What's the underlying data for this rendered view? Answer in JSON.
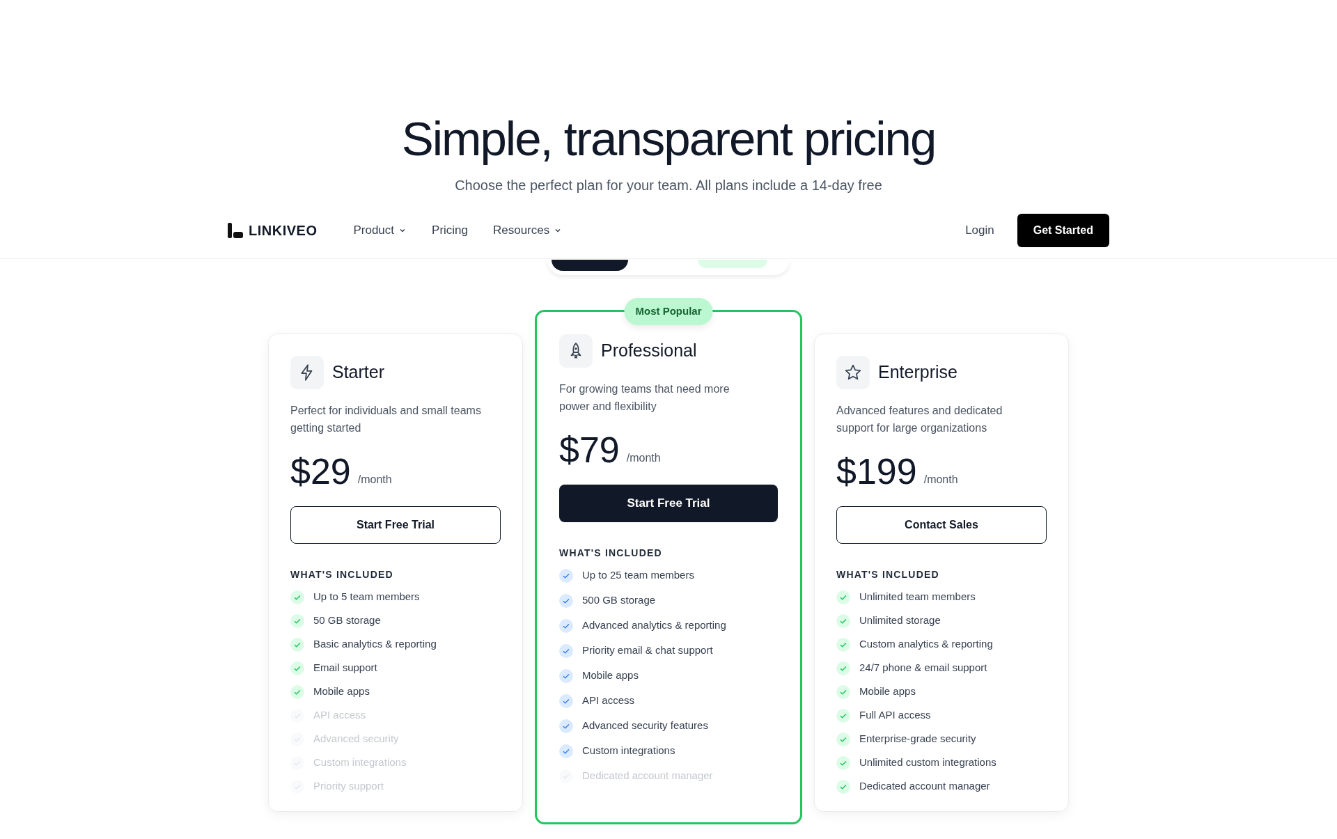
{
  "hero": {
    "title": "Simple, transparent pricing",
    "subtitle": "Choose the perfect plan for your team. All plans include a 14-day free"
  },
  "nav": {
    "logo": "LINKIVEO",
    "links": [
      {
        "label": "Product",
        "dropdown": true
      },
      {
        "label": "Pricing",
        "dropdown": false
      },
      {
        "label": "Resources",
        "dropdown": true
      }
    ],
    "login": "Login",
    "cta": "Get Started"
  },
  "plans": [
    {
      "name": "Starter",
      "description": "Perfect for individuals and small teams getting started",
      "price": "$29",
      "period": "/month",
      "button": "Start Free Trial",
      "highlighted": false,
      "features_heading": "WHAT'S INCLUDED",
      "features": [
        {
          "label": "Up to 5 team members",
          "included": true
        },
        {
          "label": "50 GB storage",
          "included": true
        },
        {
          "label": "Basic analytics & reporting",
          "included": true
        },
        {
          "label": "Email support",
          "included": true
        },
        {
          "label": "Mobile apps",
          "included": true
        },
        {
          "label": "API access",
          "included": false
        },
        {
          "label": "Advanced security",
          "included": false
        },
        {
          "label": "Custom integrations",
          "included": false
        },
        {
          "label": "Priority support",
          "included": false
        }
      ]
    },
    {
      "name": "Professional",
      "badge": "Most Popular",
      "description": "For growing teams that need more power and flexibility",
      "price": "$79",
      "period": "/month",
      "button": "Start Free Trial",
      "highlighted": true,
      "features_heading": "WHAT'S INCLUDED",
      "features": [
        {
          "label": "Up to 25 team members",
          "included": true
        },
        {
          "label": "500 GB storage",
          "included": true
        },
        {
          "label": "Advanced analytics & reporting",
          "included": true
        },
        {
          "label": "Priority email & chat support",
          "included": true
        },
        {
          "label": "Mobile apps",
          "included": true
        },
        {
          "label": "API access",
          "included": true
        },
        {
          "label": "Advanced security features",
          "included": true
        },
        {
          "label": "Custom integrations",
          "included": true
        },
        {
          "label": "Dedicated account manager",
          "included": false
        }
      ]
    },
    {
      "name": "Enterprise",
      "description": "Advanced features and dedicated support for large organizations",
      "price": "$199",
      "period": "/month",
      "button": "Contact Sales",
      "highlighted": false,
      "features_heading": "WHAT'S INCLUDED",
      "features": [
        {
          "label": "Unlimited team members",
          "included": true
        },
        {
          "label": "Unlimited storage",
          "included": true
        },
        {
          "label": "Custom analytics & reporting",
          "included": true
        },
        {
          "label": "24/7 phone & email support",
          "included": true
        },
        {
          "label": "Mobile apps",
          "included": true
        },
        {
          "label": "Full API access",
          "included": true
        },
        {
          "label": "Enterprise-grade security",
          "included": true
        },
        {
          "label": "Unlimited custom integrations",
          "included": true
        },
        {
          "label": "Dedicated account manager",
          "included": true
        }
      ]
    }
  ]
}
